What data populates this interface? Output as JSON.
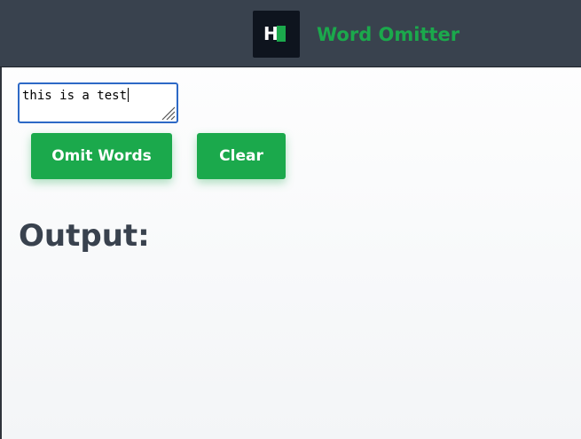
{
  "header": {
    "logo_letter": "H",
    "title": "Word Omitter"
  },
  "input": {
    "value": "this is a test"
  },
  "buttons": {
    "omit_label": "Omit Words",
    "clear_label": "Clear"
  },
  "output": {
    "heading": "Output:",
    "value": ""
  },
  "colors": {
    "header_bg": "#39424e",
    "accent": "#1ba94c",
    "logo_bg": "#0e141e",
    "input_border": "#2d69c6",
    "heading_text": "#39424e"
  },
  "icons": {
    "logo": "hackerrank-logo-icon",
    "resize": "resize-grip-icon"
  }
}
